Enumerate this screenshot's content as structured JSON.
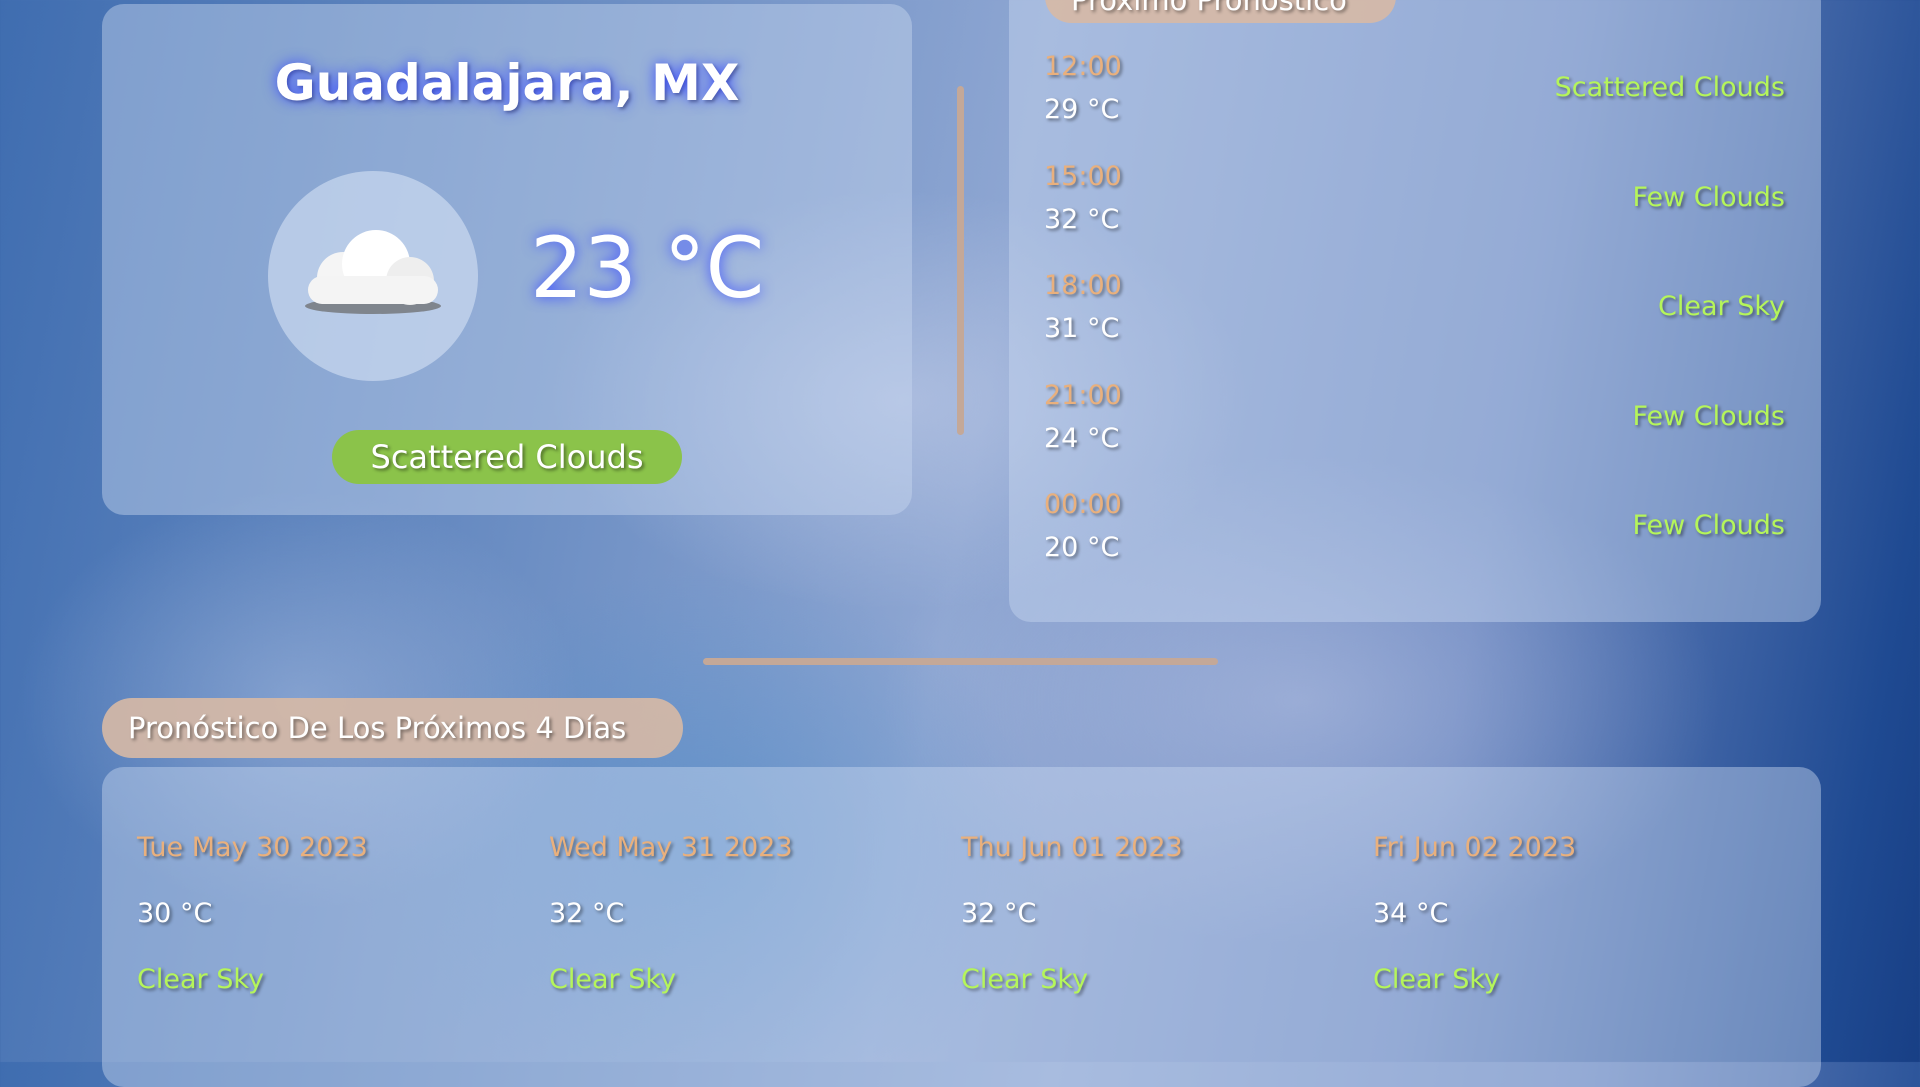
{
  "current": {
    "city": "Guadalajara, MX",
    "temperature": "23 °C",
    "description": "Scattered Clouds",
    "icon": "cloud-icon"
  },
  "next_forecast": {
    "title": "Próximo Pronóstico",
    "items": [
      {
        "time": "12:00",
        "temp": "29 °C",
        "desc": "Scattered Clouds"
      },
      {
        "time": "15:00",
        "temp": "32 °C",
        "desc": "Few Clouds"
      },
      {
        "time": "18:00",
        "temp": "31 °C",
        "desc": "Clear Sky"
      },
      {
        "time": "21:00",
        "temp": "24 °C",
        "desc": "Few Clouds"
      },
      {
        "time": "00:00",
        "temp": "20 °C",
        "desc": "Few Clouds"
      }
    ]
  },
  "days_forecast": {
    "title": "Pronóstico De Los Próximos 4 Días",
    "items": [
      {
        "date": "Tue May 30 2023",
        "temp": "30 °C",
        "desc": "Clear Sky"
      },
      {
        "date": "Wed May 31 2023",
        "temp": "32 °C",
        "desc": "Clear Sky"
      },
      {
        "date": "Thu Jun 01 2023",
        "temp": "32 °C",
        "desc": "Clear Sky"
      },
      {
        "date": "Fri Jun 02 2023",
        "temp": "34 °C",
        "desc": "Clear Sky"
      }
    ]
  },
  "colors": {
    "time": "#e9b07d",
    "desc": "#b5f55a",
    "pill": "#d7b9a5",
    "badge": "#8bc34a"
  }
}
